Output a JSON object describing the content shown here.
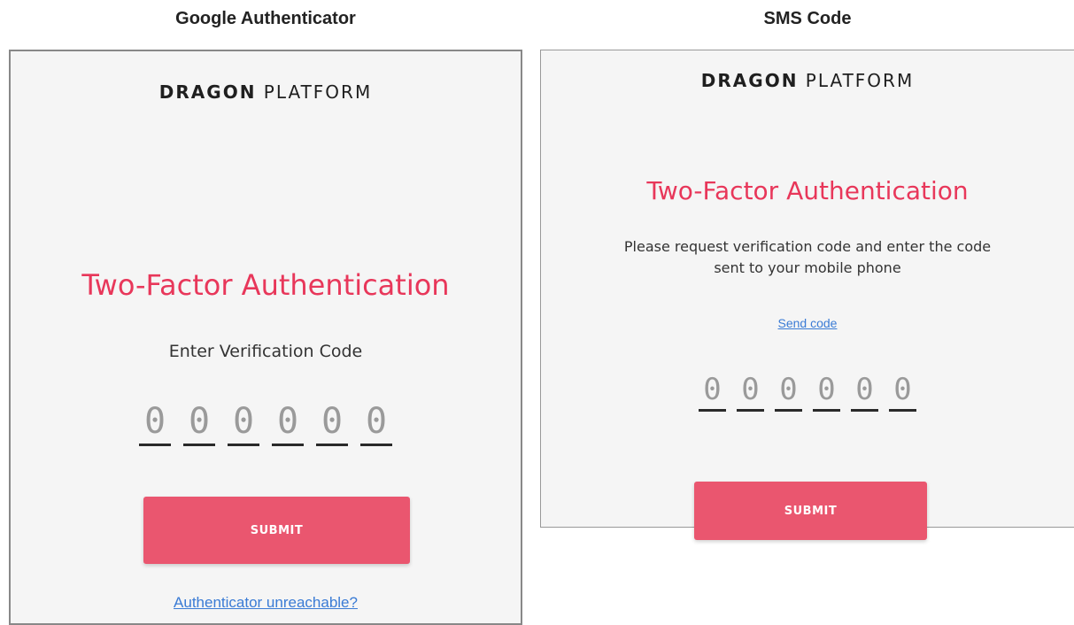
{
  "left_caption": "Google Authenticator",
  "right_caption": "SMS Code",
  "google_panel": {
    "brand_bold": "DRAGON",
    "brand_light": " PLATFORM",
    "title": "Two-Factor Authentication",
    "subtitle": "Enter Verification Code",
    "code_digits": [
      "0",
      "0",
      "0",
      "0",
      "0",
      "0"
    ],
    "submit_label": "SUBMIT",
    "help_link": "Authenticator unreachable?"
  },
  "sms_panel": {
    "brand_bold": "DRAGON",
    "brand_light": " PLATFORM",
    "title": "Two-Factor Authentication",
    "instructions_line1": "Please request verification code and enter the code",
    "instructions_line2": "sent to your mobile phone",
    "send_code_link": "Send code",
    "code_digits": [
      "0",
      "0",
      "0",
      "0",
      "0",
      "0"
    ],
    "submit_label": "SUBMIT"
  },
  "colors": {
    "accent_title": "#e8375a",
    "button_bg": "#ea566f",
    "link": "#3a7bd5",
    "panel_bg": "#f5f5f5"
  }
}
